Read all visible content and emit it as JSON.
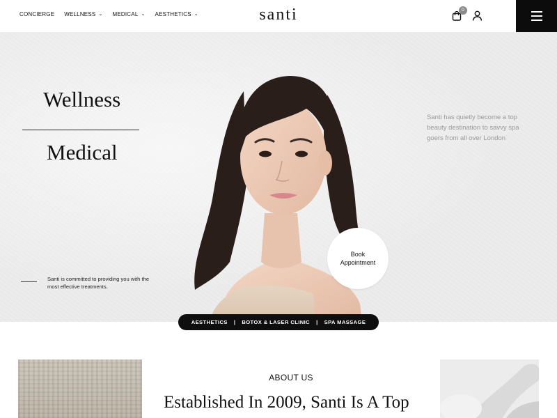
{
  "header": {
    "nav": [
      {
        "label": "CONCIERGE",
        "dropdown": false
      },
      {
        "label": "WELLNESS",
        "dropdown": true
      },
      {
        "label": "MEDICAL",
        "dropdown": true
      },
      {
        "label": "AESTHETICS",
        "dropdown": true
      }
    ],
    "logo": "santi",
    "cart_count": "0",
    "icons": [
      "cart-icon",
      "user-icon",
      "hamburger-menu-icon"
    ]
  },
  "hero": {
    "word1": "Wellness",
    "word2": "Medical",
    "committed_text": "Santi is committed to providing you with the most effective treatments.",
    "right_text": "Santi has quietly become a top beauty destination to savvy spa goers from all over London",
    "book": {
      "line1": "Book",
      "line2": "Appointment"
    },
    "pill": [
      "AESTHETICS",
      "BOTOX & LASER CLINIC",
      "SPA MASSAGE"
    ],
    "pill_separator": "|"
  },
  "about": {
    "label": "ABOUT US",
    "title": "Established In 2009, Santi Is A Top"
  },
  "colors": {
    "dark": "#0c0c0c",
    "hero_bg": "#ececec",
    "muted_text": "#999999"
  }
}
